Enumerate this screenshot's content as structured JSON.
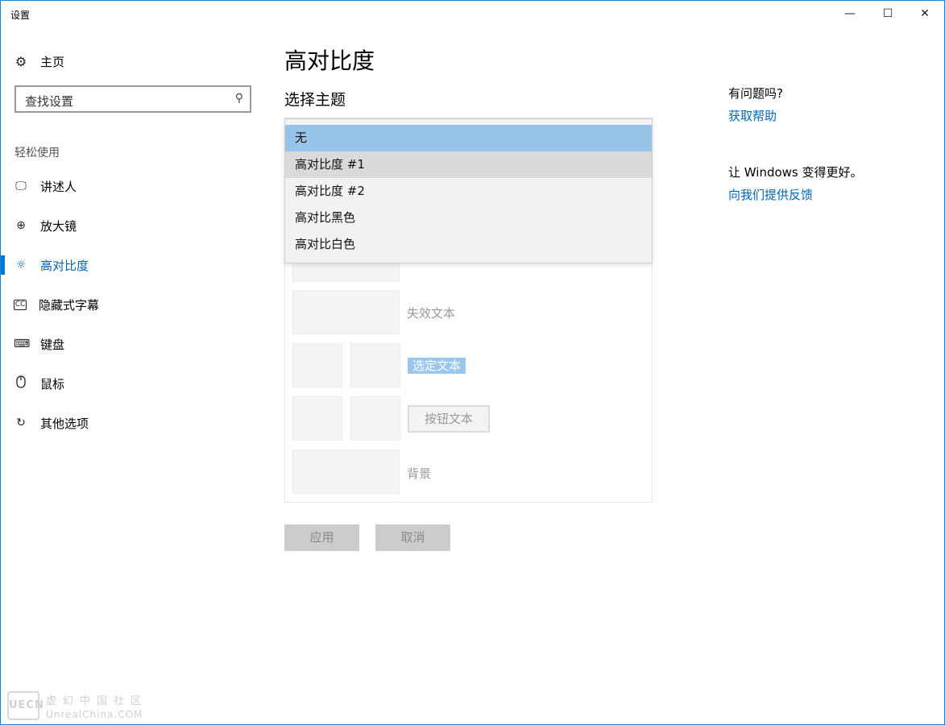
{
  "window": {
    "title": "设置",
    "min_glyph": "—",
    "max_glyph": "☐",
    "close_glyph": "✕"
  },
  "sidebar": {
    "home_label": "主页",
    "search_placeholder": "查找设置",
    "section_label": "轻松使用",
    "items": [
      {
        "label": "讲述人",
        "icon": "narrator-icon"
      },
      {
        "label": "放大镜",
        "icon": "magnifier-icon"
      },
      {
        "label": "高对比度",
        "icon": "brightness-icon",
        "active": true
      },
      {
        "label": "隐藏式字幕",
        "icon": "cc-icon"
      },
      {
        "label": "键盘",
        "icon": "keyboard-icon"
      },
      {
        "label": "鼠标",
        "icon": "mouse-icon"
      },
      {
        "label": "其他选项",
        "icon": "other-options-icon"
      }
    ]
  },
  "main": {
    "title": "高对比度",
    "subtitle": "选择主题",
    "dropdown": {
      "options": [
        "无",
        "高对比度 #1",
        "高对比度 #2",
        "高对比黑色",
        "高对比白色"
      ],
      "selected": "无",
      "hovered": "高对比度 #1"
    },
    "preview": {
      "disabled_text": "失效文本",
      "selected_text": "选定文本",
      "button_text": "按钮文本",
      "background": "背景"
    },
    "apply_label": "应用",
    "cancel_label": "取消"
  },
  "right": {
    "help_question": "有问题吗?",
    "help_link": "获取帮助",
    "feedback_prompt": "让 Windows 变得更好。",
    "feedback_link": "向我们提供反馈"
  },
  "watermark": {
    "logo": "UECN",
    "line1": "虚幻中国社区",
    "line2": "UnrealChina.COM"
  },
  "colors": {
    "accent": "#0078d7",
    "link": "#0067b8",
    "selected_option": "#99c4e9"
  }
}
